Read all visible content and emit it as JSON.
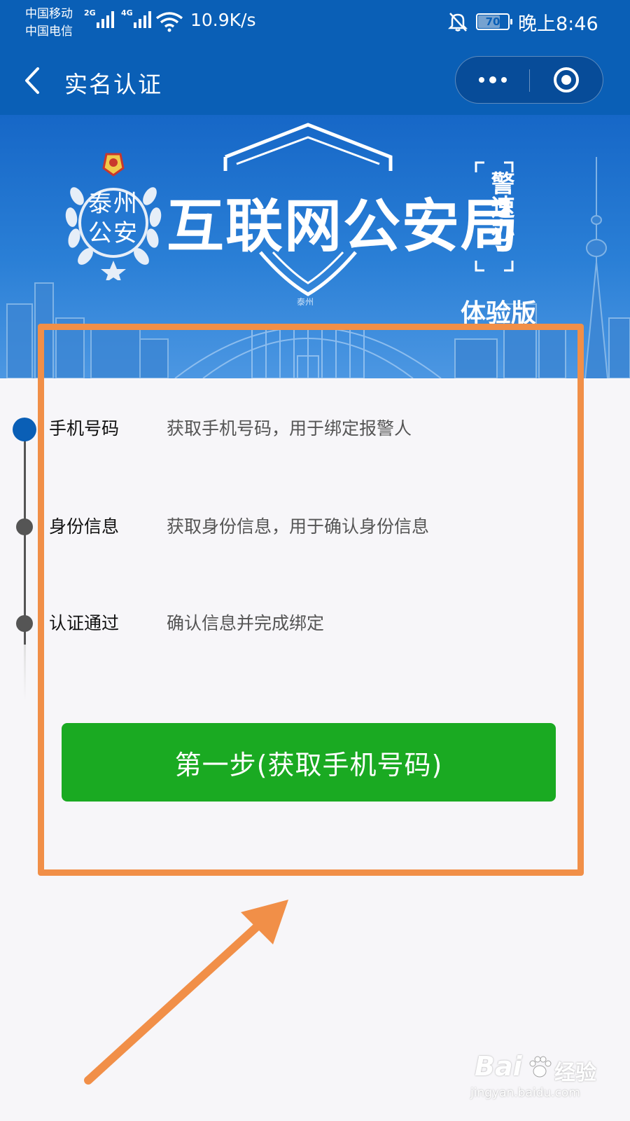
{
  "status_bar": {
    "carrier_1": "中国移动",
    "carrier_2": "中国电信",
    "network_1": "2G",
    "network_2": "4G",
    "net_speed": "10.9K/s",
    "battery": "70",
    "time": "晚上8:46"
  },
  "nav": {
    "title": "实名认证",
    "back_icon": "chevron-left-icon",
    "more_icon": "more-dots-icon",
    "close_icon": "target-circle-icon"
  },
  "banner": {
    "emblem_text": "泰州公安",
    "title": "互联网公安局",
    "quick_badge": "警速办",
    "edition": "体验版",
    "building_sign": "泰州"
  },
  "steps": [
    {
      "name": "手机号码",
      "desc": "获取手机号码，用于绑定报警人",
      "active": true
    },
    {
      "name": "身份信息",
      "desc": "获取身份信息，用于确认身份信息",
      "active": false
    },
    {
      "name": "认证通过",
      "desc": "确认信息并完成绑定",
      "active": false
    }
  ],
  "primary_button": {
    "label": "第一步(获取手机号码)"
  },
  "watermark": {
    "brand": "Bai",
    "cn": "经验",
    "domain": "jingyan.baidu.com"
  },
  "colors": {
    "header_blue": "#0a5fb6",
    "button_green": "#1aaa22",
    "annotation_orange": "#f18f48",
    "background": "#f7f6f9"
  }
}
